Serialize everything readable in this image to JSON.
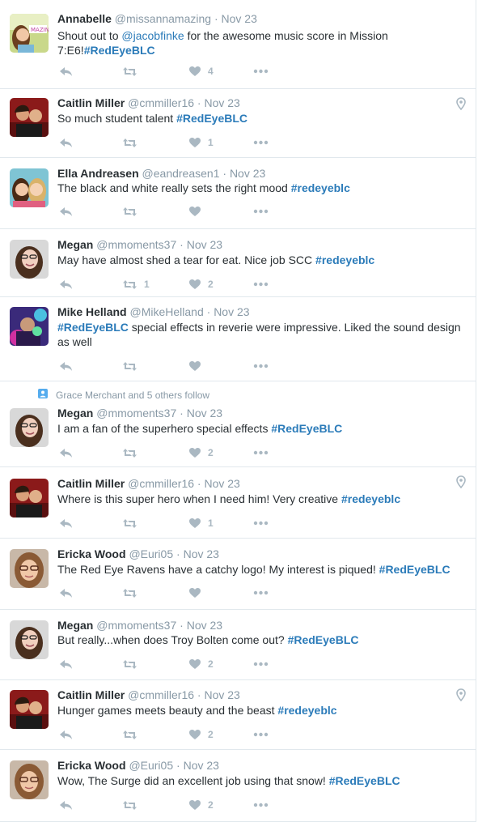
{
  "tweets": [
    {
      "name": "Annabelle",
      "handle": "@missannamazing",
      "time": "Nov 23",
      "segments": [
        {
          "t": "Shout out to "
        },
        {
          "t": "@jacobfinke",
          "k": "mention"
        },
        {
          "t": " for the awesome music score in Mission 7:E6!"
        },
        {
          "t": "#RedEyeBLC",
          "k": "tag"
        }
      ],
      "retweets": "",
      "likes": "4",
      "geo": false,
      "social": "",
      "avatar": "annabelle"
    },
    {
      "name": "Caitlin Miller",
      "handle": "@cmmiller16",
      "time": "Nov 23",
      "segments": [
        {
          "t": "So much student talent "
        },
        {
          "t": "#RedEyeBLC",
          "k": "tag"
        }
      ],
      "retweets": "",
      "likes": "1",
      "geo": true,
      "social": "",
      "avatar": "caitlin"
    },
    {
      "name": "Ella Andreasen",
      "handle": "@eandreasen1",
      "time": "Nov 23",
      "segments": [
        {
          "t": "The black and white really sets the right mood "
        },
        {
          "t": "#redeyeblc",
          "k": "tag"
        }
      ],
      "retweets": "",
      "likes": "",
      "geo": false,
      "social": "",
      "avatar": "ella"
    },
    {
      "name": "Megan",
      "handle": "@mmoments37",
      "time": "Nov 23",
      "segments": [
        {
          "t": "May have almost shed a tear for eat. Nice job SCC "
        },
        {
          "t": "#redeyeblc",
          "k": "tag"
        }
      ],
      "retweets": "1",
      "likes": "2",
      "geo": false,
      "social": "",
      "avatar": "megan"
    },
    {
      "name": "Mike Helland",
      "handle": "@MikeHelland",
      "time": "Nov 23",
      "segments": [
        {
          "t": "#RedEyeBLC",
          "k": "tag"
        },
        {
          "t": " special effects in reverie were impressive. Liked the sound design as well"
        }
      ],
      "retweets": "",
      "likes": "",
      "geo": false,
      "social": "",
      "avatar": "mike"
    },
    {
      "name": "Megan",
      "handle": "@mmoments37",
      "time": "Nov 23",
      "segments": [
        {
          "t": "I am a fan of the superhero special effects "
        },
        {
          "t": "#RedEyeBLC",
          "k": "tag"
        }
      ],
      "retweets": "",
      "likes": "2",
      "geo": false,
      "social": "Grace Merchant and 5 others follow",
      "avatar": "megan"
    },
    {
      "name": "Caitlin Miller",
      "handle": "@cmmiller16",
      "time": "Nov 23",
      "segments": [
        {
          "t": "Where is this super hero when I need him! Very creative "
        },
        {
          "t": "#redeyeblc",
          "k": "tag"
        }
      ],
      "retweets": "",
      "likes": "1",
      "geo": true,
      "social": "",
      "avatar": "caitlin"
    },
    {
      "name": "Ericka Wood",
      "handle": "@Euri05",
      "time": "Nov 23",
      "segments": [
        {
          "t": "The Red Eye Ravens have a catchy logo! My interest is piqued!  "
        },
        {
          "t": "#RedEyeBLC",
          "k": "tag"
        }
      ],
      "retweets": "",
      "likes": "",
      "geo": false,
      "social": "",
      "avatar": "ericka"
    },
    {
      "name": "Megan",
      "handle": "@mmoments37",
      "time": "Nov 23",
      "segments": [
        {
          "t": "But really...when does Troy Bolten come out? "
        },
        {
          "t": "#RedEyeBLC",
          "k": "tag"
        }
      ],
      "retweets": "",
      "likes": "2",
      "geo": false,
      "social": "",
      "avatar": "megan"
    },
    {
      "name": "Caitlin Miller",
      "handle": "@cmmiller16",
      "time": "Nov 23",
      "segments": [
        {
          "t": "Hunger games meets beauty and the beast "
        },
        {
          "t": "#redeyeblc",
          "k": "tag"
        }
      ],
      "retweets": "",
      "likes": "2",
      "geo": true,
      "social": "",
      "avatar": "caitlin"
    },
    {
      "name": "Ericka Wood",
      "handle": "@Euri05",
      "time": "Nov 23",
      "segments": [
        {
          "t": "Wow, The Surge did an excellent job using that snow!  "
        },
        {
          "t": "#RedEyeBLC",
          "k": "tag"
        }
      ],
      "retweets": "",
      "likes": "2",
      "geo": false,
      "social": "",
      "avatar": "ericka"
    }
  ],
  "ui": {
    "separator": "·",
    "accent": "#2b7bb9",
    "muted": "#8899a6",
    "icon_color": "#aab8c2"
  },
  "icons": {
    "reply": "reply-icon",
    "retweet": "retweet-icon",
    "like": "heart-icon",
    "more": "more-icon",
    "geo": "location-pin-icon",
    "social": "person-icon"
  }
}
